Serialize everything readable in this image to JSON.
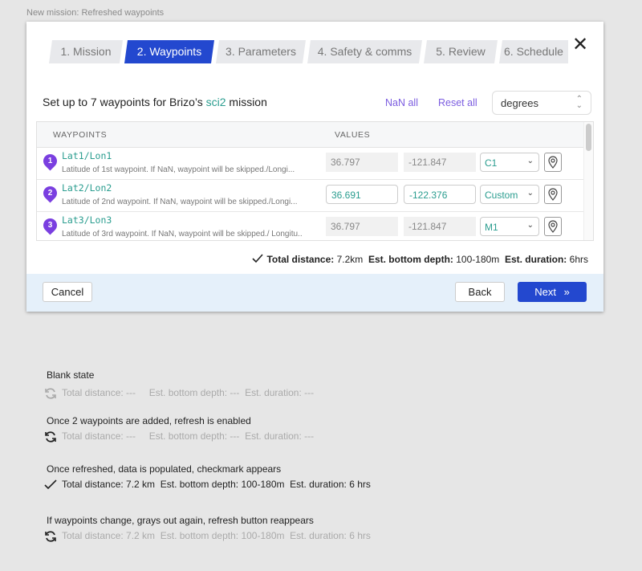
{
  "caption": "New mission: Refreshed waypoints",
  "tabs": [
    "1. Mission",
    "2. Waypoints",
    "3. Parameters",
    "4. Safety & comms",
    "5. Review",
    "6. Schedule"
  ],
  "active_tab": 1,
  "heading": {
    "prefix": "Set up to 7 waypoints for Brizo’s ",
    "mission": "sci2",
    "suffix": " mission"
  },
  "actions": {
    "nan_all": "NaN all",
    "reset_all": "Reset all",
    "unit": "degrees"
  },
  "table": {
    "headers": [
      "WAYPOINTS",
      "VALUES"
    ],
    "rows": [
      {
        "num": "1",
        "name": "Lat1/Lon1",
        "desc": "Latitude of 1st waypoint. If NaN, waypoint will be skipped./Longi...",
        "lat": "36.797",
        "lon": "-121.847",
        "preset": "C1",
        "editable": false
      },
      {
        "num": "2",
        "name": "Lat2/Lon2",
        "desc": "Latitude of 2nd waypoint. If NaN, waypoint will be skipped./Longi...",
        "lat": "36.691",
        "lon": "-122.376",
        "preset": "Custom",
        "editable": true
      },
      {
        "num": "3",
        "name": "Lat3/Lon3",
        "desc": "Latitude of 3rd waypoint. If NaN, waypoint will be skipped./ Longitu..",
        "lat": "36.797",
        "lon": "-121.847",
        "preset": "M1",
        "editable": false
      }
    ]
  },
  "summary": {
    "dist_label": "Total distance:",
    "dist": " 7.2km",
    "depth_label": "Est. bottom depth:",
    "depth": " 100-180m",
    "dur_label": "Est. duration:",
    "dur": " 6hrs"
  },
  "footer": {
    "cancel": "Cancel",
    "back": "Back",
    "next": "Next"
  },
  "states": [
    {
      "title": "Blank state",
      "line": "Total distance: ---     Est. bottom depth: ---  Est. duration: ---",
      "icon": "refresh-icon-disabled"
    },
    {
      "title": "Once 2 waypoints are added, refresh is enabled",
      "line": "Total distance: ---     Est. bottom depth: ---  Est. duration: ---",
      "icon": "refresh-icon"
    },
    {
      "title": "Once refreshed, data is populated, checkmark appears",
      "line": "Total distance: 7.2 km  Est. bottom depth: 100-180m  Est. duration: 6 hrs",
      "icon": "checkmark-icon"
    },
    {
      "title": "If waypoints change, grays out again, refresh button reappears",
      "line": "Total distance: 7.2 km  Est. bottom depth: 100-180m  Est. duration: 6 hrs",
      "icon": "refresh-icon"
    }
  ],
  "colors": {
    "primary": "#2348cf",
    "teal": "#2a9d8f",
    "purple": "#7a3fe0",
    "link": "#7b5ce0"
  }
}
